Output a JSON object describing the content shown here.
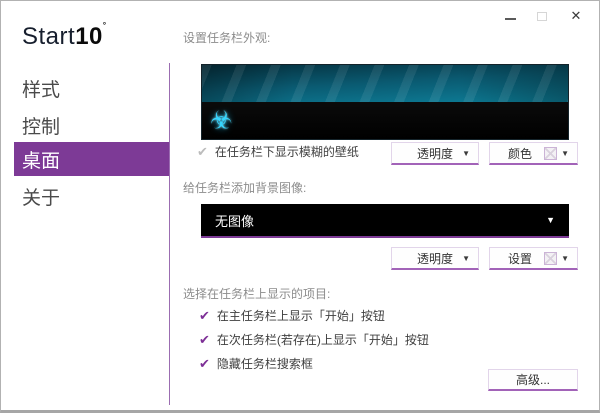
{
  "window": {
    "controls": {
      "minimize_icon": "minimize-line",
      "maximize_icon": "maximize-box",
      "close_glyph": "✕"
    }
  },
  "icons": {
    "checkmark": "✔",
    "dropdown_arrow": "▼",
    "biohazard": "☣"
  },
  "colors": {
    "accent_purple": "#7d3a96",
    "button_underline": "#a263b8",
    "divider": "#9b6db1",
    "preview_teal": "#0d7f99",
    "biohazard_cyan": "#35d6ff",
    "dropdown_bg": "#000000"
  },
  "sidebar": {
    "logo": {
      "prefix": "Start",
      "number": "10",
      "mark": "˚"
    },
    "items": [
      {
        "label": "样式",
        "selected": false
      },
      {
        "label": "控制",
        "selected": false
      },
      {
        "label": "桌面",
        "selected": true
      },
      {
        "label": "关于",
        "selected": false
      }
    ]
  },
  "content": {
    "section1": {
      "label": "设置任务栏外观:",
      "checkbox": {
        "label": "在任务栏下显示模糊的壁纸",
        "checked": true,
        "enabled": false
      },
      "transparency_button": "透明度",
      "color_button": "颜色"
    },
    "section2": {
      "label": "给任务栏添加背景图像:",
      "dropdown_value": "无图像",
      "transparency_button": "透明度",
      "settings_button": "设置"
    },
    "section3": {
      "label": "选择在任务栏上显示的项目:",
      "options": [
        {
          "label": "在主任务栏上显示「开始」按钮",
          "checked": true
        },
        {
          "label": "在次任务栏(若存在)上显示「开始」按钮",
          "checked": true
        },
        {
          "label": "隐藏任务栏搜索框",
          "checked": true
        }
      ],
      "advanced_button": "高级..."
    }
  }
}
